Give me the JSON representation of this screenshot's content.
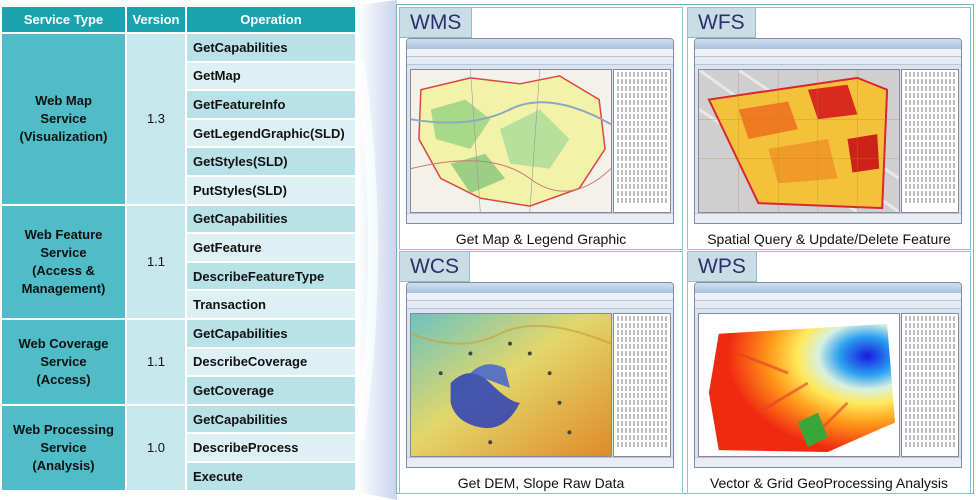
{
  "table": {
    "headers": [
      "Service Type",
      "Version",
      "Operation"
    ],
    "groups": [
      {
        "type_lines": [
          "Web Map",
          "Service",
          "(Visualization)"
        ],
        "version": "1.3",
        "operations": [
          "GetCapabilities",
          "GetMap",
          "GetFeatureInfo",
          "GetLegendGraphic(SLD)",
          "GetStyles(SLD)",
          "PutStyles(SLD)"
        ]
      },
      {
        "type_lines": [
          "Web Feature",
          "Service",
          "(Access &",
          "Management)"
        ],
        "version": "1.1",
        "operations": [
          "GetCapabilities",
          "GetFeature",
          "DescribeFeatureType",
          "Transaction"
        ]
      },
      {
        "type_lines": [
          "Web Coverage",
          "Service",
          "(Access)"
        ],
        "version": "1.1",
        "operations": [
          "GetCapabilities",
          "DescribeCoverage",
          "GetCoverage"
        ]
      },
      {
        "type_lines": [
          "Web Processing",
          "Service",
          "(Analysis)"
        ],
        "version": "1.0",
        "operations": [
          "GetCapabilities",
          "DescribeProcess",
          "Execute"
        ]
      }
    ]
  },
  "panels": {
    "wms": {
      "tag": "WMS",
      "caption": "Get Map & Legend Graphic"
    },
    "wfs": {
      "tag": "WFS",
      "caption": "Spatial Query & Update/Delete Feature"
    },
    "wcs": {
      "tag": "WCS",
      "caption": "Get DEM, Slope Raw Data"
    },
    "wps": {
      "tag": "WPS",
      "caption": "Vector & Grid GeoProcessing Analysis"
    }
  },
  "colors": {
    "header": "#18a3ae",
    "type_band_a": "#4fbcc7",
    "type_band_b": "#c6e7ec",
    "op_a": "#b9e2e8",
    "op_b": "#ddf1f4",
    "panel_border": "#6fb2c4"
  }
}
